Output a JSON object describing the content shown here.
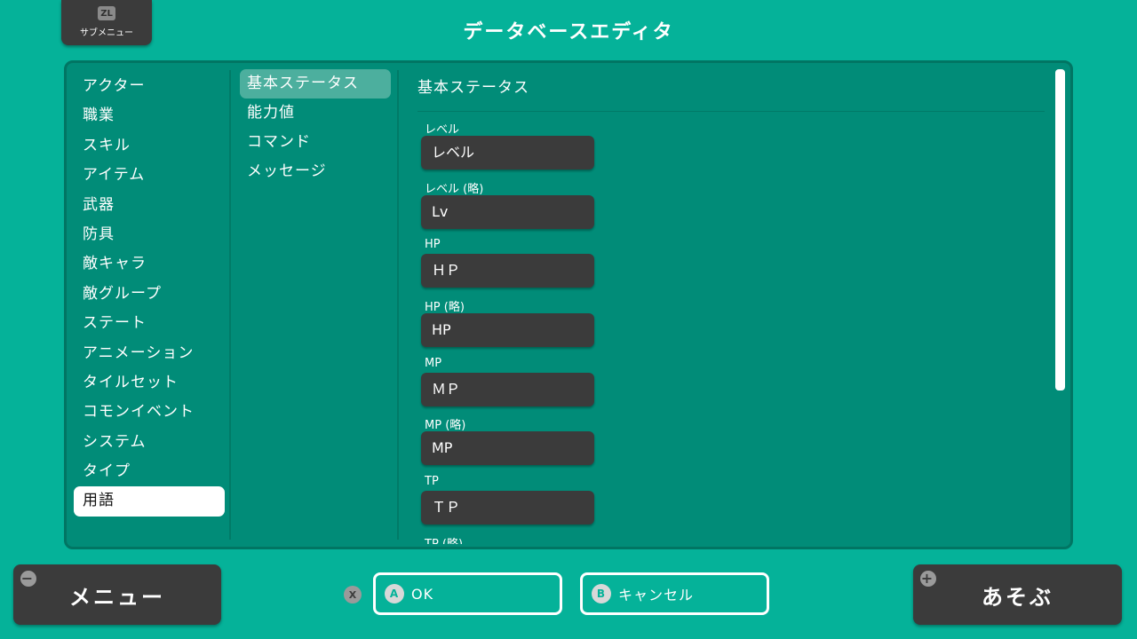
{
  "header": {
    "submenu_button_icon": "ZL",
    "submenu_button_label": "サブメニュー",
    "title": "データベースエディタ"
  },
  "categories": [
    {
      "label": "アクター"
    },
    {
      "label": "職業"
    },
    {
      "label": "スキル"
    },
    {
      "label": "アイテム"
    },
    {
      "label": "武器"
    },
    {
      "label": "防具"
    },
    {
      "label": "敵キャラ"
    },
    {
      "label": "敵グループ"
    },
    {
      "label": "ステート"
    },
    {
      "label": "アニメーション"
    },
    {
      "label": "タイルセット"
    },
    {
      "label": "コモンイベント"
    },
    {
      "label": "システム"
    },
    {
      "label": "タイプ"
    },
    {
      "label": "用語",
      "selected": true
    }
  ],
  "subcategories": [
    {
      "label": "基本ステータス",
      "selected": true
    },
    {
      "label": "能力値"
    },
    {
      "label": "コマンド"
    },
    {
      "label": "メッセージ"
    }
  ],
  "content": {
    "section_title": "基本ステータス",
    "fields": [
      {
        "label": "レベル",
        "value": "レベル"
      },
      {
        "label": "レベル (略)",
        "value": "Lv"
      },
      {
        "label": "HP",
        "value": "ＨＰ"
      },
      {
        "label": "HP (略)",
        "value": "HP"
      },
      {
        "label": "MP",
        "value": "ＭＰ"
      },
      {
        "label": "MP (略)",
        "value": "MP"
      },
      {
        "label": "TP",
        "value": "ＴＰ"
      },
      {
        "label": "TP (略)",
        "value": ""
      }
    ]
  },
  "footer": {
    "menu_button": {
      "label": "メニュー",
      "icon": "minus-icon",
      "icon_glyph": "−"
    },
    "x_hint": "X",
    "ok_button": {
      "icon": "A",
      "label": "OK"
    },
    "cancel_button": {
      "icon": "B",
      "label": "キャンセル"
    },
    "play_button": {
      "label": "あそぶ",
      "icon": "plus-icon",
      "icon_glyph": "+"
    }
  },
  "colors": {
    "background": "#05b299",
    "panel": "#018c78",
    "dark_button": "#3b3b3b",
    "selected_item": "#ffffff",
    "selected_subitem": "#4caf9e"
  }
}
